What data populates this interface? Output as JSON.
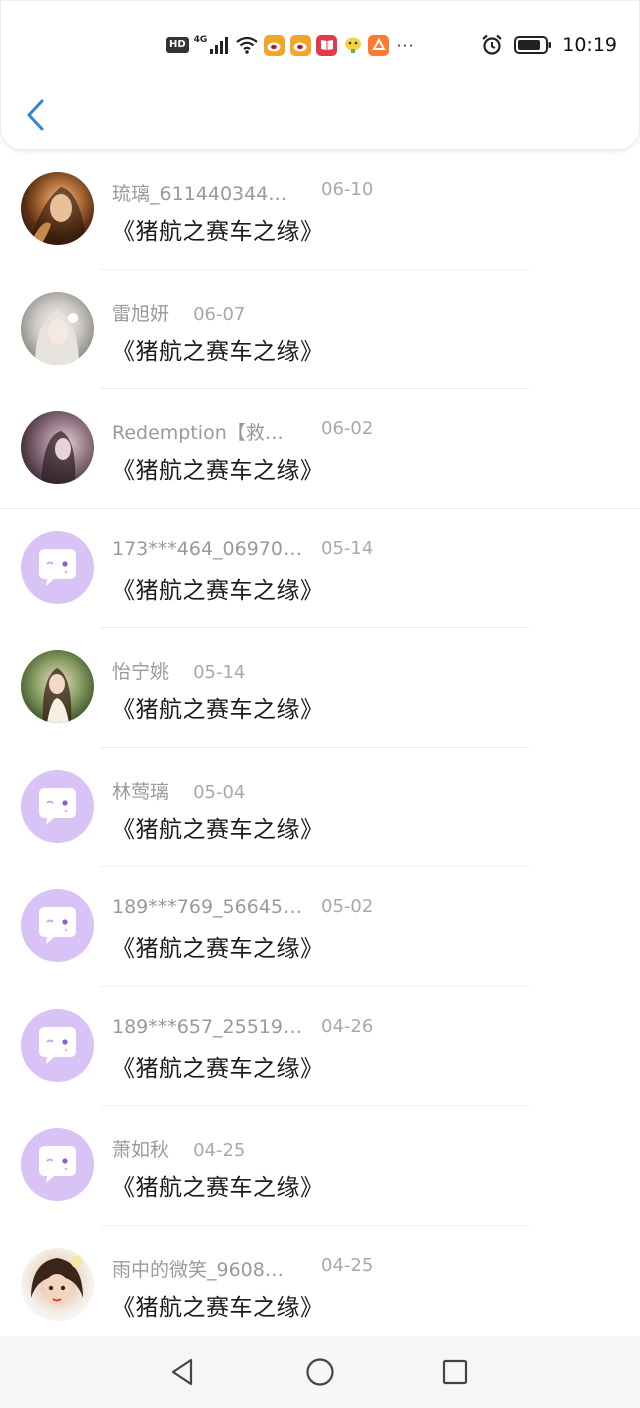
{
  "status_bar": {
    "time": "10:19",
    "network": "HD",
    "signal_label": "4G",
    "icons": [
      "hd-icon",
      "signal-4g-icon",
      "wifi-icon",
      "weibo-icon",
      "weibo-icon",
      "book-app-icon",
      "tieba-icon",
      "taobao-icon",
      "more-icon",
      "alarm-icon",
      "battery-icon"
    ],
    "more": "···"
  },
  "header": {
    "back_icon": "chevron-left-icon",
    "accent_color": "#2f86d6"
  },
  "messages": [
    {
      "name": "琉璃_611440344…",
      "date": "06-10",
      "title": "《猪航之赛车之缘》",
      "avatar": "photo"
    },
    {
      "name": "雷旭妍",
      "date": "06-07",
      "title": "《猪航之赛车之缘》",
      "avatar": "photo"
    },
    {
      "name": "Redemption【救…",
      "date": "06-02",
      "title": "《猪航之赛车之缘》",
      "avatar": "photo"
    },
    {
      "name": "173***464_06970…",
      "date": "05-14",
      "title": "《猪航之赛车之缘》",
      "avatar": "default"
    },
    {
      "name": "怡宁姚",
      "date": "05-14",
      "title": "《猪航之赛车之缘》",
      "avatar": "photo"
    },
    {
      "name": "林莺璃",
      "date": "05-04",
      "title": "《猪航之赛车之缘》",
      "avatar": "default"
    },
    {
      "name": "189***769_56645…",
      "date": "05-02",
      "title": "《猪航之赛车之缘》",
      "avatar": "default"
    },
    {
      "name": "189***657_25519…",
      "date": "04-26",
      "title": "《猪航之赛车之缘》",
      "avatar": "default"
    },
    {
      "name": "萧如秋",
      "date": "04-25",
      "title": "《猪航之赛车之缘》",
      "avatar": "default"
    },
    {
      "name": "雨中的微笑_9608…",
      "date": "04-25",
      "title": "《猪航之赛车之缘》",
      "avatar": "photo"
    }
  ],
  "colors": {
    "default_avatar": "#d9c2f5",
    "name_text": "#9a9a9a",
    "title_text": "#1c1c1c"
  },
  "nav_bar": {
    "icons": [
      "back-triangle-icon",
      "home-circle-icon",
      "recents-square-icon"
    ]
  }
}
